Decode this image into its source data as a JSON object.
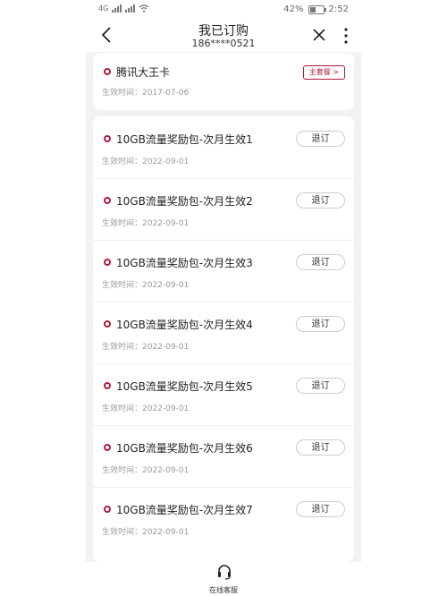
{
  "status_bar": {
    "carrier_left": "4G",
    "battery_percent": "42%",
    "time": "2:52"
  },
  "header": {
    "title": "我已订购",
    "phone": "186****0521"
  },
  "main_plan": {
    "name": "腾讯大王卡",
    "date": "生效时间：2017-07-06",
    "badge": "主套餐 >"
  },
  "addons": [
    {
      "name": "10GB流量奖励包-次月生效1",
      "date": "生效时间：2022-09-01",
      "action": "退订"
    },
    {
      "name": "10GB流量奖励包-次月生效2",
      "date": "生效时间：2022-09-01",
      "action": "退订"
    },
    {
      "name": "10GB流量奖励包-次月生效3",
      "date": "生效时间：2022-09-01",
      "action": "退订"
    },
    {
      "name": "10GB流量奖励包-次月生效4",
      "date": "生效时间：2022-09-01",
      "action": "退订"
    },
    {
      "name": "10GB流量奖励包-次月生效5",
      "date": "生效时间：2022-09-01",
      "action": "退订"
    },
    {
      "name": "10GB流量奖励包-次月生效6",
      "date": "生效时间：2022-09-01",
      "action": "退订"
    },
    {
      "name": "10GB流量奖励包-次月生效7",
      "date": "生效时间：2022-09-01",
      "action": "退订"
    }
  ],
  "bottom": {
    "customer_service": "在线客服"
  },
  "colors": {
    "accent": "#b01b3a",
    "background": "#f2f2f2"
  }
}
